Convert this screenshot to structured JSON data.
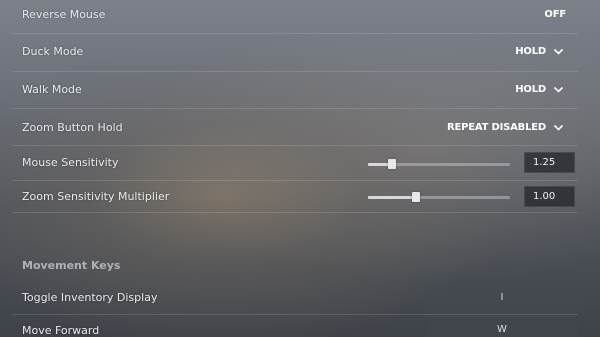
{
  "settings": [
    {
      "label": "Reverse Mouse",
      "value": "OFF",
      "dropdown": false
    },
    {
      "label": "Duck Mode",
      "value": "HOLD",
      "dropdown": true
    },
    {
      "label": "Walk Mode",
      "value": "HOLD",
      "dropdown": true
    },
    {
      "label": "Zoom Button Hold",
      "value": "REPEAT DISABLED",
      "dropdown": true
    }
  ],
  "sliders": [
    {
      "label": "Mouse Sensitivity",
      "value": "1.25",
      "level": 0.17
    },
    {
      "label": "Zoom Sensitivity Multiplier",
      "value": "1.00",
      "level": 0.34
    }
  ],
  "movement": {
    "title": "Movement Keys",
    "keys": [
      {
        "label": "Toggle Inventory Display",
        "key": "I"
      },
      {
        "label": "Move Forward",
        "key": "W"
      }
    ]
  },
  "icons": {
    "dropdown": "chevron-down-icon"
  },
  "colors": {
    "text": "#e9eaee",
    "value": "#ffffff",
    "divider": "rgba(255,255,255,0.13)",
    "input_bg": "#20242a"
  }
}
